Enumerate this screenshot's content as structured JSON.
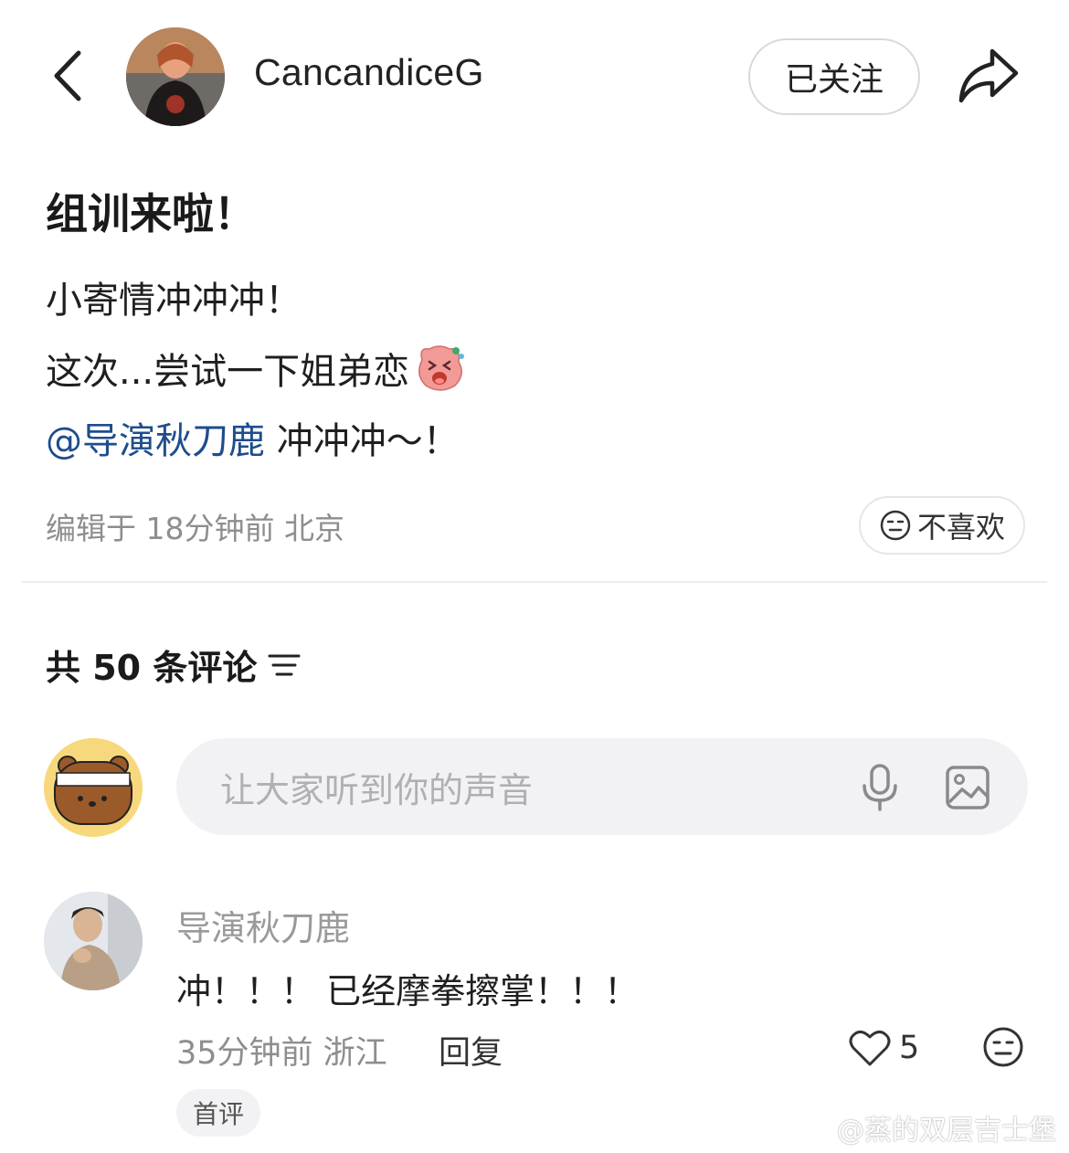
{
  "header": {
    "username": "CancandiceG",
    "follow_label": "已关注"
  },
  "post": {
    "title": "组训来啦！",
    "line1": "小寄情冲冲冲！",
    "line2": "这次...尝试一下姐弟恋",
    "line3_mention": "@导演秋刀鹿",
    "line3_rest": " 冲冲冲～！",
    "meta": "编辑于 18分钟前 北京",
    "dislike_label": "不喜欢"
  },
  "comments": {
    "header": "共 50 条评论",
    "input_placeholder": "让大家听到你的声音",
    "items": [
      {
        "name": "导演秋刀鹿",
        "text": "冲！！！ 已经摩拳擦掌！！！",
        "meta": "35分钟前 浙江",
        "reply_label": "回复",
        "likes": "5",
        "badge": "首评"
      }
    ]
  },
  "watermark": "@蒸的双层吉士堡",
  "icons": {
    "back": "chevron-left-icon",
    "share": "share-arrow-icon",
    "emoji": "laughing-emoji-icon",
    "dislike": "neutral-face-icon",
    "filter": "sort-filter-icon",
    "mic": "microphone-icon",
    "image": "image-icon",
    "like": "heart-icon",
    "weibo": "weibo-logo-icon"
  },
  "colors": {
    "mention": "#1e4d8c",
    "meta_gray": "#8e8e8e",
    "input_bg": "#f2f2f4"
  }
}
